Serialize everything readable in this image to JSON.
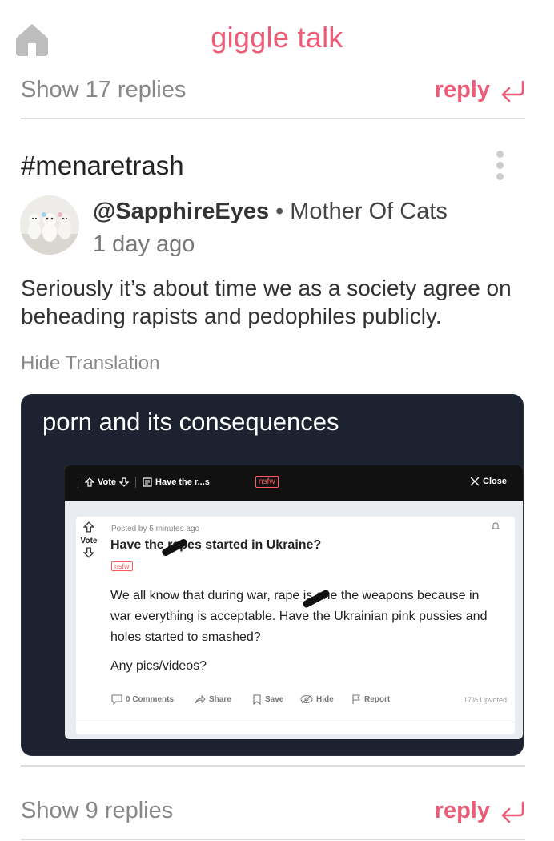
{
  "header": {
    "title": "giggle talk"
  },
  "top_replies": {
    "show_label": "Show 17 replies",
    "reply_label": "reply"
  },
  "post": {
    "tag": "#menaretrash",
    "author_handle": "@SapphireEyes",
    "author_separator": "•",
    "author_subtitle": "Mother Of Cats",
    "timestamp": "1 day ago",
    "text": "Seriously it’s about time we as a society agree on beheading rapists and pedophiles publicly.",
    "hide_translation": "Hide Translation",
    "media": {
      "caption": "porn and its consequences",
      "screenshot": {
        "bar": {
          "vote": "Vote",
          "title": "Have the r...s ...",
          "nsfw": "nsfw",
          "close": "Close"
        },
        "posted_by": "Posted by 5 minutes ago",
        "vote_label": "Vote",
        "title": "Have the rapes started in Ukraine?",
        "nsfw": "nsfw",
        "body": "We all know that during war, rape is one the weapons because in war everything is acceptable. Have the Ukrainian pink pussies and holes started to smashed?",
        "question": "Any pics/videos?",
        "actions": {
          "comments": "0 Comments",
          "share": "Share",
          "save": "Save",
          "hide": "Hide",
          "report": "Report"
        },
        "upvoted": "17% Upvoted"
      }
    }
  },
  "bottom_replies": {
    "show_label": "Show 9 replies",
    "reply_label": "reply"
  },
  "colors": {
    "accent": "#ee5b77",
    "muted": "#888888",
    "media_bg": "#1c2230"
  }
}
